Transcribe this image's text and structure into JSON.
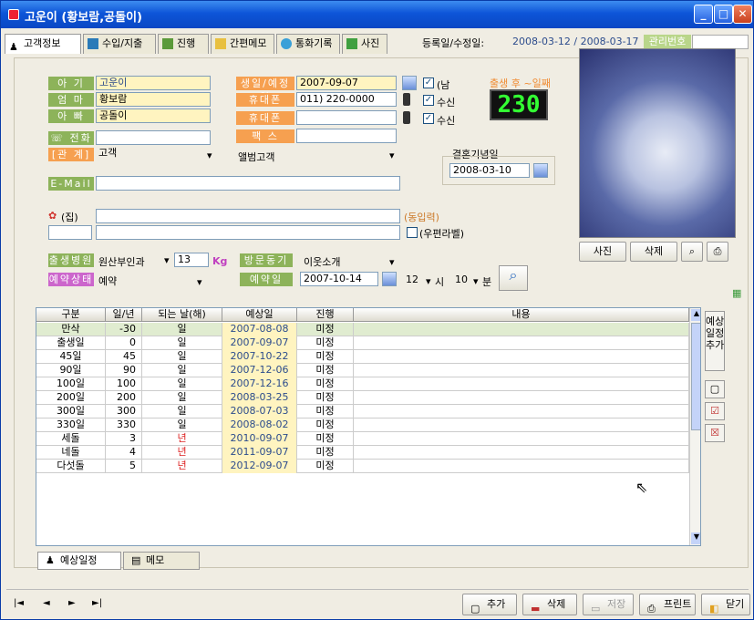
{
  "window": {
    "title": "고운이 (황보람,공돌이)"
  },
  "tabs": [
    "고객정보",
    "수입/지출",
    "진행",
    "간편메모",
    "통화기록",
    "사진"
  ],
  "reg": {
    "label": "등록일/수정일:",
    "value": "2008-03-12 / 2008-03-17",
    "mgmt_label": "관리번호"
  },
  "form": {
    "baby_label": "아  기",
    "baby_value": "고운이",
    "mother_label": "엄  마",
    "mother_value": "황보람",
    "father_label": "아  빠",
    "father_value": "공돌이",
    "home_label": "☏ 전화",
    "home_value": "",
    "rel_label": "[관  계]",
    "rel_value": "고객",
    "email_label": "E-Mail",
    "email_value": "",
    "addr_label": "(집)",
    "addr_value": "",
    "addr2_value": "",
    "addr_input_label": "(동입력)",
    "postal_label": "(우편라벨)",
    "birth_label": "생일/예정일",
    "birth_value": "2007-09-07",
    "male_label": "(남",
    "mobile1_label": "휴대폰",
    "mobile1_value": "011) 220-0000",
    "recv1_label": "수신",
    "mobile2_label": "휴대폰",
    "mobile2_value": "",
    "recv2_label": "수신",
    "fax_label": "팩  스",
    "fax_value": "",
    "group_value": "앨범고객",
    "after_birth_label": "출생 후 ~일째",
    "after_birth_value": "230",
    "anniv_label": "결혼기념일",
    "anniv_value": "2008-03-10",
    "hospital_label": "출생병원",
    "hospital_value": "원산부인과",
    "weight_value": "13",
    "weight_unit": "Kg",
    "visit_label": "방문동기",
    "visit_value": "이웃소개",
    "resv_state_label": "예약상태",
    "resv_state_value": "예약",
    "resv_date_label": "예약일",
    "resv_date_value": "2007-10-14",
    "hour_value": "12",
    "hour_label": "시",
    "min_value": "10",
    "min_label": "분"
  },
  "photo_buttons": [
    "사진",
    "삭제"
  ],
  "grid": {
    "headers": [
      "구분",
      "일/년",
      "되는 날(해)",
      "예상일",
      "진행",
      "내용"
    ],
    "rows": [
      [
        "만삭",
        "-30",
        "일",
        "2007-08-08",
        "미정",
        ""
      ],
      [
        "출생일",
        "0",
        "일",
        "2007-09-07",
        "미정",
        ""
      ],
      [
        "45일",
        "45",
        "일",
        "2007-10-22",
        "미정",
        ""
      ],
      [
        "90일",
        "90",
        "일",
        "2007-12-06",
        "미정",
        ""
      ],
      [
        "100일",
        "100",
        "일",
        "2007-12-16",
        "미정",
        ""
      ],
      [
        "200일",
        "200",
        "일",
        "2008-03-25",
        "미정",
        ""
      ],
      [
        "300일",
        "300",
        "일",
        "2008-07-03",
        "미정",
        ""
      ],
      [
        "330일",
        "330",
        "일",
        "2008-08-02",
        "미정",
        ""
      ],
      [
        "세돌",
        "3",
        "년",
        "2010-09-07",
        "미정",
        ""
      ],
      [
        "네돌",
        "4",
        "년",
        "2011-09-07",
        "미정",
        ""
      ],
      [
        "다섯돌",
        "5",
        "년",
        "2012-09-07",
        "미정",
        ""
      ]
    ]
  },
  "side": {
    "add_schedule": "예상\n일정\n추가"
  },
  "bottom_tabs": [
    "예상일정",
    "메모"
  ],
  "nav": [
    "|◄",
    "◄",
    "►",
    "►|"
  ],
  "buttons": {
    "add": "추가",
    "delete": "삭제",
    "save": "저장",
    "print": "프린트",
    "close": "닫기"
  },
  "colors": {
    "label_green": "#8db35a",
    "label_orange": "#f6a050",
    "label_pink": "#cc66cc",
    "year_red": "#dd2222",
    "title_blue": "#0d55d8"
  }
}
